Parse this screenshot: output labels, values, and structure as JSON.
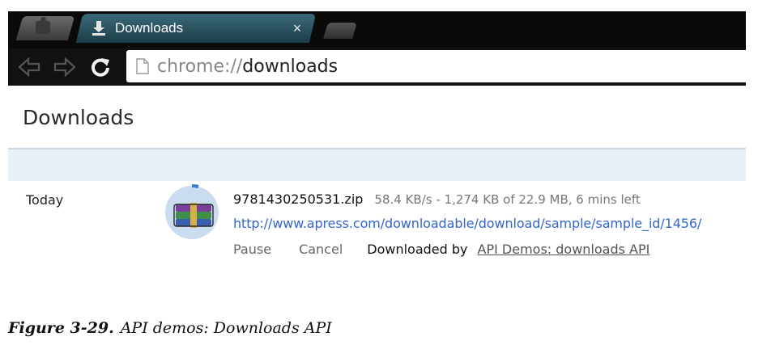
{
  "browser": {
    "active_tab_title": "Downloads",
    "tab_close_glyph": "×",
    "url_scheme": "chrome://",
    "url_host": "downloads",
    "icons": [
      "extensions-icon",
      "download-icon",
      "back-icon",
      "forward-icon",
      "reload-icon",
      "page-icon"
    ]
  },
  "page": {
    "title": "Downloads",
    "accent_color": "#e9f0f7"
  },
  "download": {
    "date_group": "Today",
    "file_name": "9781430250531.zip",
    "progress": "58.4 KB/s - 1,274 KB of 22.9 MB, 6 mins left",
    "url": "http://www.apress.com/downloadable/download/sample/sample_id/1456/",
    "pause_label": "Pause",
    "cancel_label": "Cancel",
    "downloaded_by_label": "Downloaded by",
    "extension_name": "API Demos: downloads API",
    "icon": "winrar-archive-icon"
  },
  "caption": {
    "label": "Figure 3-29.",
    "text": "API demos: Downloads API"
  }
}
